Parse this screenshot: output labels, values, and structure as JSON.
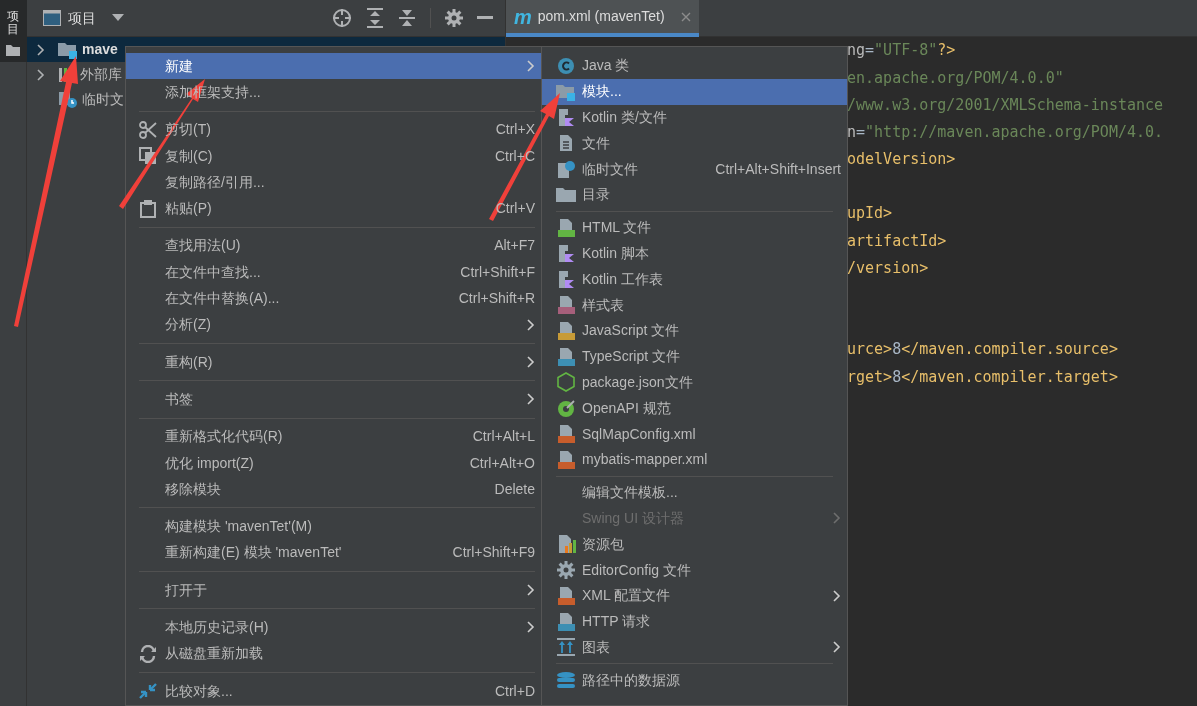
{
  "tool_stripe": {
    "tab_label": "项目",
    "selected": true
  },
  "project_panel": {
    "title": "项目",
    "tree": [
      {
        "label": "mave",
        "selected": true,
        "expanded": false
      },
      {
        "label": "外部库",
        "selected": false,
        "expanded": false
      },
      {
        "label": "临时文",
        "selected": false
      }
    ]
  },
  "editor_tab": {
    "icon_text": "m",
    "title": "pom.xml (mavenTet)",
    "selected": true
  },
  "code_lines": [
    {
      "kind": "code",
      "segments": [
        {
          "kind": "attr",
          "text": "ng"
        },
        {
          "kind": "plain",
          "text": "="
        },
        {
          "kind": "value",
          "text": "\"UTF-8\""
        },
        {
          "kind": "tag",
          "text": "?>"
        }
      ]
    },
    {
      "kind": "code",
      "segments": [
        {
          "kind": "value",
          "text": "en.apache.org/POM/4.0.0\""
        }
      ]
    },
    {
      "kind": "code",
      "segments": [
        {
          "kind": "value",
          "text": "/www.w3.org/2001/XMLSchema-instance"
        }
      ]
    },
    {
      "kind": "code",
      "segments": [
        {
          "kind": "attr",
          "text": "n"
        },
        {
          "kind": "plain",
          "text": "="
        },
        {
          "kind": "value",
          "text": "\"http://maven.apache.org/POM/4.0."
        }
      ]
    },
    {
      "kind": "code",
      "segments": [
        {
          "kind": "tag",
          "text": "odelVersion>"
        }
      ]
    },
    {
      "kind": "blank"
    },
    {
      "kind": "code",
      "segments": [
        {
          "kind": "tag",
          "text": "upId>"
        }
      ]
    },
    {
      "kind": "code",
      "segments": [
        {
          "kind": "tag",
          "text": "artifactId>"
        }
      ]
    },
    {
      "kind": "code",
      "segments": [
        {
          "kind": "tag",
          "text": "/version>"
        }
      ]
    },
    {
      "kind": "blank"
    },
    {
      "kind": "blank"
    },
    {
      "kind": "code",
      "segments": [
        {
          "kind": "tag",
          "text": "urce>"
        },
        {
          "kind": "plain",
          "text": "8"
        },
        {
          "kind": "tag",
          "text": "</maven.compiler.source>"
        }
      ]
    },
    {
      "kind": "code",
      "segments": [
        {
          "kind": "tag",
          "text": "rget>"
        },
        {
          "kind": "plain",
          "text": "8"
        },
        {
          "kind": "tag",
          "text": "</maven.compiler.target>"
        }
      ]
    }
  ],
  "context_menu": {
    "items": [
      {
        "kind": "item",
        "label": "新建",
        "submenu": true,
        "selected": true
      },
      {
        "kind": "item",
        "label": "添加框架支持...",
        "selected": false
      },
      {
        "kind": "separator"
      },
      {
        "kind": "item",
        "label": "剪切(T)",
        "shortcut": "Ctrl+X",
        "selected": false
      },
      {
        "kind": "item",
        "label": "复制(C)",
        "shortcut": "Ctrl+C",
        "selected": false
      },
      {
        "kind": "item",
        "label": "复制路径/引用...",
        "selected": false
      },
      {
        "kind": "item",
        "label": "粘贴(P)",
        "shortcut": "Ctrl+V",
        "selected": false
      },
      {
        "kind": "separator"
      },
      {
        "kind": "item",
        "label": "查找用法(U)",
        "shortcut": "Alt+F7",
        "selected": false
      },
      {
        "kind": "item",
        "label": "在文件中查找...",
        "shortcut": "Ctrl+Shift+F",
        "selected": false
      },
      {
        "kind": "item",
        "label": "在文件中替换(A)...",
        "shortcut": "Ctrl+Shift+R",
        "selected": false
      },
      {
        "kind": "item",
        "label": "分析(Z)",
        "submenu": true,
        "selected": false
      },
      {
        "kind": "separator"
      },
      {
        "kind": "item",
        "label": "重构(R)",
        "submenu": true,
        "selected": false
      },
      {
        "kind": "separator"
      },
      {
        "kind": "item",
        "label": "书签",
        "submenu": true,
        "selected": false
      },
      {
        "kind": "separator"
      },
      {
        "kind": "item",
        "label": "重新格式化代码(R)",
        "shortcut": "Ctrl+Alt+L",
        "selected": false
      },
      {
        "kind": "item",
        "label": "优化 import(Z)",
        "shortcut": "Ctrl+Alt+O",
        "selected": false
      },
      {
        "kind": "item",
        "label": "移除模块",
        "shortcut": "Delete",
        "selected": false
      },
      {
        "kind": "separator"
      },
      {
        "kind": "item",
        "label": "构建模块 'mavenTet'(M)",
        "selected": false
      },
      {
        "kind": "item",
        "label": "重新构建(E) 模块 'mavenTet'",
        "shortcut": "Ctrl+Shift+F9",
        "selected": false
      },
      {
        "kind": "separator"
      },
      {
        "kind": "item",
        "label": "打开于",
        "submenu": true,
        "selected": false
      },
      {
        "kind": "separator"
      },
      {
        "kind": "item",
        "label": "本地历史记录(H)",
        "submenu": true,
        "selected": false
      },
      {
        "kind": "item",
        "label": "从磁盘重新加载",
        "selected": false
      },
      {
        "kind": "separator"
      },
      {
        "kind": "item",
        "label": "比较对象...",
        "shortcut": "Ctrl+D",
        "selected": false
      }
    ]
  },
  "new_submenu": {
    "items": [
      {
        "kind": "item",
        "label": "Java 类",
        "selected": false
      },
      {
        "kind": "item",
        "label": "模块...",
        "selected": true
      },
      {
        "kind": "item",
        "label": "Kotlin 类/文件",
        "selected": false
      },
      {
        "kind": "item",
        "label": "文件",
        "selected": false
      },
      {
        "kind": "item",
        "label": "临时文件",
        "shortcut": "Ctrl+Alt+Shift+Insert",
        "selected": false
      },
      {
        "kind": "item",
        "label": "目录",
        "selected": false
      },
      {
        "kind": "separator"
      },
      {
        "kind": "item",
        "label": "HTML 文件",
        "selected": false
      },
      {
        "kind": "item",
        "label": "Kotlin 脚本",
        "selected": false
      },
      {
        "kind": "item",
        "label": "Kotlin 工作表",
        "selected": false
      },
      {
        "kind": "item",
        "label": "样式表",
        "selected": false
      },
      {
        "kind": "item",
        "label": "JavaScript 文件",
        "selected": false
      },
      {
        "kind": "item",
        "label": "TypeScript 文件",
        "selected": false
      },
      {
        "kind": "item",
        "label": "package.json文件",
        "selected": false
      },
      {
        "kind": "item",
        "label": "OpenAPI 规范",
        "selected": false
      },
      {
        "kind": "item",
        "label": "SqlMapConfig.xml",
        "selected": false
      },
      {
        "kind": "item",
        "label": "mybatis-mapper.xml",
        "selected": false
      },
      {
        "kind": "separator"
      },
      {
        "kind": "item",
        "label": "编辑文件模板...",
        "selected": false
      },
      {
        "kind": "item",
        "label": "Swing UI 设计器",
        "submenu": true,
        "disabled": true,
        "selected": false
      },
      {
        "kind": "item",
        "label": "资源包",
        "selected": false
      },
      {
        "kind": "item",
        "label": "EditorConfig 文件",
        "selected": false
      },
      {
        "kind": "item",
        "label": "XML 配置文件",
        "submenu": true,
        "selected": false
      },
      {
        "kind": "item",
        "label": "HTTP 请求",
        "selected": false
      },
      {
        "kind": "item",
        "label": "图表",
        "submenu": true,
        "selected": false
      },
      {
        "kind": "separator"
      },
      {
        "kind": "item",
        "label": "路径中的数据源",
        "selected": false
      }
    ]
  }
}
